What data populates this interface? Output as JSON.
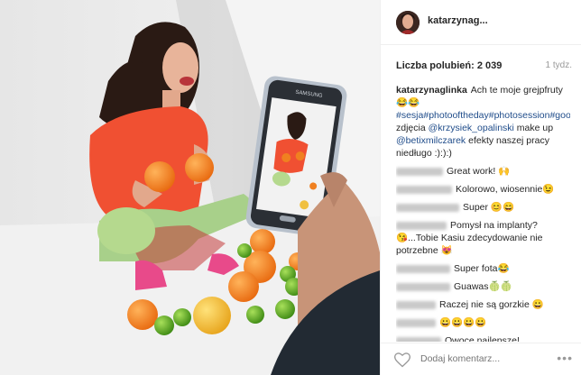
{
  "post": {
    "username": "katarzynag...",
    "likes": "Liczba polubień: 2 039",
    "time": "1 tydz.",
    "caption": {
      "author": "katarzynaglinka",
      "text_1": "Ach te moje grejpfruty 😂😂",
      "hashtags": "#sesja#photooftheday#photosession#goodvibes#goodvibesonly#",
      "text_2": " zdjęcia ",
      "mention_1": "@krzysiek_opalinski",
      "text_3": " make up ",
      "mention_2": "@betixmilczarek",
      "text_4": " efekty naszej pracy niedługo :):):)"
    },
    "comments": [
      {
        "text": "Great work! 🙌",
        "blur_width": 52
      },
      {
        "text": "Kolorowo, wiosennie😉",
        "blur_width": 62
      },
      {
        "text": "Super 😊😄",
        "blur_width": 70
      },
      {
        "text": "Pomysł na implanty? 😘...Tobie Kasiu zdecydowanie nie potrzebne 😻",
        "blur_width": 56
      },
      {
        "text": "Super fota😂",
        "blur_width": 60
      },
      {
        "text": "Guawas🍈🍈",
        "blur_width": 60
      },
      {
        "text": "Raczej nie są gorzkie 😀",
        "blur_width": 44
      },
      {
        "text": "😀😀😀😀",
        "blur_width": 44
      },
      {
        "text": "Owoce najlepsze!",
        "blur_width": 50
      }
    ],
    "add_comment_placeholder": "Dodaj komentarz...",
    "more_label": "•••"
  }
}
